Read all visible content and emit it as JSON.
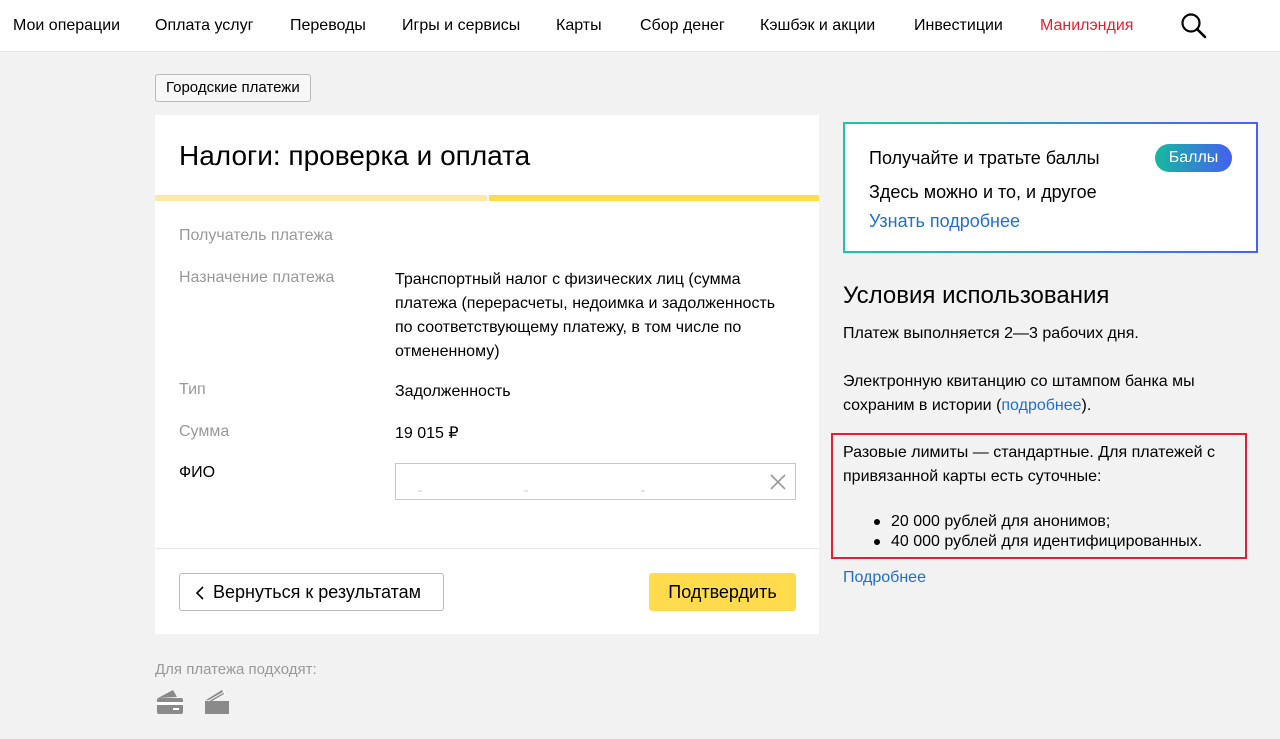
{
  "nav": {
    "items": [
      {
        "label": "Мои операции"
      },
      {
        "label": "Оплата услуг"
      },
      {
        "label": "Переводы"
      },
      {
        "label": "Игры и сервисы"
      },
      {
        "label": "Карты"
      },
      {
        "label": "Сбор денег"
      },
      {
        "label": "Кэшбэк и акции"
      },
      {
        "label": "Инвестиции"
      },
      {
        "label": "Манилэндия"
      }
    ],
    "search_icon": "search-icon",
    "accent_color": "#e4202e"
  },
  "breadcrumb": "Городские платежи",
  "form": {
    "title": "Налоги: проверка и оплата",
    "progress_percent": 50,
    "recipient_label": "Получатель платежа",
    "purpose_label": "Назначение платежа",
    "purpose_value": "Транспортный налог с физических лиц (сумма платежа (перерасчеты, недоимка и задолженность по соответствующему платежу, в том числе по отмененному)",
    "type_label": "Тип",
    "type_value": "Задолженность",
    "sum_label": "Сумма",
    "sum_value": "19 015 ₽",
    "fio_label": "ФИО",
    "fio_value": "",
    "back_button": "Вернуться к результатам",
    "confirm_button": "Подтвердить",
    "confirm_color": "#ffdb4d"
  },
  "payment_methods": {
    "label": "Для платежа подходят:",
    "icons": [
      "card-icon",
      "wallet-icon"
    ]
  },
  "promo": {
    "line1": "Получайте и тратьте баллы",
    "line2": "Здесь можно и то, и другое",
    "link": "Узнать подробнее",
    "badge": "Баллы"
  },
  "conditions": {
    "title": "Условия использования",
    "p1": "Платеж выполняется 2—3 рабочих дня.",
    "p2_a": "Электронную квитанцию со штампом банка мы",
    "p2_b": "сохраним в истории (",
    "p2_link": "подробнее",
    "p2_c": ").",
    "limits_a": "Разовые лимиты — стандартные. Для платежей с",
    "limits_b": "привязанной карты есть суточные:",
    "limit_items": [
      "20 000 рублей для анонимов;",
      "40 000 рублей для идентифицированных."
    ],
    "more_link": "Подробнее",
    "highlight_color": "#e4202e",
    "link_color": "#1e6fd0"
  }
}
